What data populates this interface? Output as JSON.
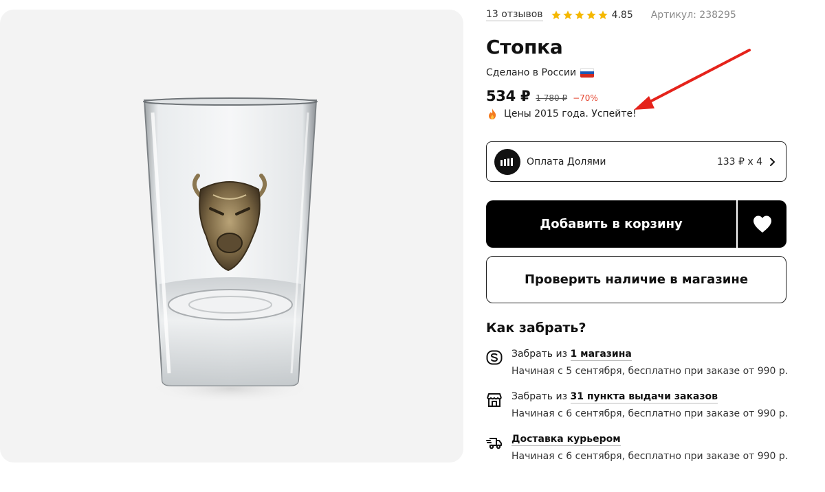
{
  "product": {
    "reviews_link": "13 отзывов",
    "rating": "4.85",
    "stars_count": 5,
    "article": "Артикул: 238295",
    "title": "Стопка",
    "made_in": "Сделано в России",
    "price": "534 ₽",
    "old_price": "1 780 ₽",
    "discount": "−70%",
    "promo": "Цены 2015 года. Успейте!"
  },
  "dolyami": {
    "label": "Оплата Долями",
    "amount": "133 ₽ x 4"
  },
  "buttons": {
    "add_to_cart": "Добавить в корзину",
    "check_stock": "Проверить наличие в магазине"
  },
  "pickup": {
    "title": "Как забрать?",
    "options": [
      {
        "prefix": "Забрать из ",
        "link": "1 магазина",
        "details": "Начиная с 5 сентября, бесплатно при заказе от 990 р.",
        "icon": "store-s-icon"
      },
      {
        "prefix": "Забрать из ",
        "link": "31 пункта выдачи заказов",
        "details": "Начиная с 6 сентября, бесплатно при заказе от 990 р.",
        "icon": "pickup-point-icon"
      },
      {
        "prefix": "",
        "link": "Доставка курьером",
        "details": "Начиная с 6 сентября, бесплатно при заказе от 990 р.",
        "icon": "courier-truck-icon"
      }
    ]
  },
  "colors": {
    "star": "#f5b800",
    "discount": "#e5452f",
    "arrow": "#e5231b",
    "button_dark": "#000000"
  }
}
